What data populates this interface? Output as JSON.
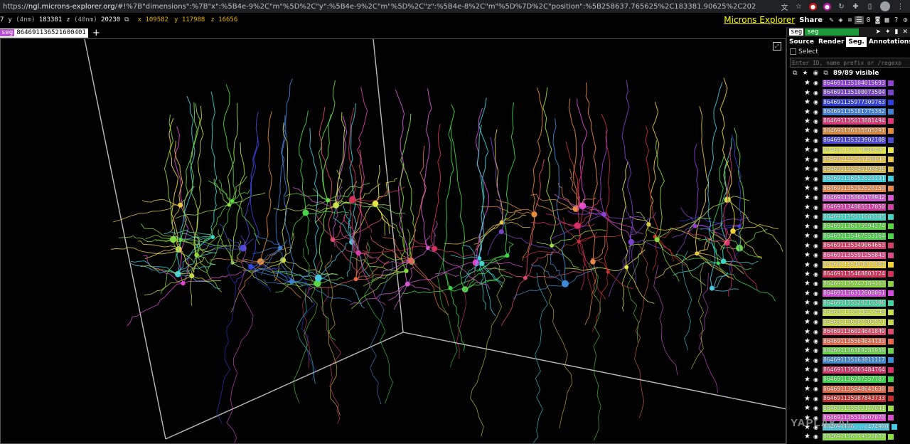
{
  "browser": {
    "url_prefix": "https://",
    "url_host": "ngl.microns-explorer.org",
    "url_rest": "/#!%7B\"dimensions\":%7B\"x\":%5B4e-9%2C\"m\"%5D%2C\"y\":%5B4e-9%2C\"m\"%5D%2C\"z\":%5B4e-8%2C\"m\"%5D%7D%2C\"position\":%5B258637.765625%2C183381.90625%2C20230.509765625%5D%2C\"crossSection..."
  },
  "toolbar": {
    "coords": [
      {
        "label": "y",
        "unit": "(4nm)",
        "value": "183381"
      },
      {
        "label": "z",
        "unit": "(40nm)",
        "value": "20230"
      }
    ],
    "coord_lead": "7",
    "orange_coords": [
      {
        "label": "x",
        "value": "109582"
      },
      {
        "label": "y",
        "value": "117988"
      },
      {
        "label": "z",
        "value": "16656"
      }
    ],
    "title": "Microns Explorer",
    "share_label": "Share"
  },
  "layer": {
    "name": "seg",
    "segment_id": "864691136521600401",
    "add_label": "+"
  },
  "panel": {
    "layer_chip": "seg",
    "layer_name": "seg",
    "tabs": [
      "Source",
      "Render",
      "Seg.",
      "Annotations"
    ],
    "selected_tab": "Seg.",
    "select_label": "Select",
    "search_placeholder": "Enter ID, name prefix or /regexp",
    "visible_count": "89/89 visible",
    "segments": [
      {
        "id": "864691135104015693",
        "color": "#8f3fd6"
      },
      {
        "id": "864691135100073504",
        "color": "#7b43c8"
      },
      {
        "id": "864691135977309763",
        "color": "#2f3fd9"
      },
      {
        "id": "864691135181775362",
        "color": "#3f7fd6"
      },
      {
        "id": "864691135013881494",
        "color": "#e0337a"
      },
      {
        "id": "864691136135505291",
        "color": "#e08a3a"
      },
      {
        "id": "864691135323902108",
        "color": "#4a4ad8"
      },
      {
        "id": "864691135279086497",
        "color": "#e8e84a"
      },
      {
        "id": "864691135345158047",
        "color": "#e8c64a"
      },
      {
        "id": "864691135345198495",
        "color": "#d8b84a"
      },
      {
        "id": "864691136952628191",
        "color": "#3fd0e0"
      },
      {
        "id": "864691135292628150",
        "color": "#e88a4a"
      },
      {
        "id": "864691135866178942",
        "color": "#d65ad6"
      },
      {
        "id": "864691134885517050",
        "color": "#d63fa8"
      },
      {
        "id": "864691135571683305",
        "color": "#3fd6c8"
      },
      {
        "id": "864691136175994374",
        "color": "#5ad63f"
      },
      {
        "id": "864691135467553164",
        "color": "#4ad64a"
      },
      {
        "id": "864691135349064663",
        "color": "#d63f6a"
      },
      {
        "id": "864691135591256843",
        "color": "#e04a8a"
      },
      {
        "id": "864691135494012304",
        "color": "#f0d43a"
      },
      {
        "id": "864691135468803724",
        "color": "#d6305a"
      },
      {
        "id": "864691135742189163",
        "color": "#8ad63f"
      },
      {
        "id": "864691136312608061",
        "color": "#d64ae0"
      },
      {
        "id": "864691135520216306",
        "color": "#3fd6a0"
      },
      {
        "id": "864691135919627440",
        "color": "#c8e04a"
      },
      {
        "id": "864691136287301571",
        "color": "#c8d64a"
      },
      {
        "id": "864691136024641849",
        "color": "#e04a6a"
      },
      {
        "id": "864691135564644183",
        "color": "#e86a4a"
      },
      {
        "id": "864691136389283959",
        "color": "#6ad64a"
      },
      {
        "id": "864691135163811117",
        "color": "#3f8ad6"
      },
      {
        "id": "864691135865484764",
        "color": "#d6306a"
      },
      {
        "id": "864691136297557787",
        "color": "#3fd64a"
      },
      {
        "id": "864691135848641630",
        "color": "#e06a4a"
      },
      {
        "id": "864691135987843733",
        "color": "#c83030"
      },
      {
        "id": "864691135562147041",
        "color": "#9ae04a"
      },
      {
        "id": "864691135510007070",
        "color": "#e04ad0"
      },
      {
        "id": "864691136...c474900",
        "color": "#4ac8e0"
      },
      {
        "id": "864691136379322837",
        "color": "#8ae03f"
      }
    ]
  },
  "watermark": "YAPLAKAL",
  "colors": {
    "accent": "#1f9a3a",
    "title": "#ffff00",
    "layer_tag": "#b84bd6",
    "orange_coords": "#e6b400"
  }
}
